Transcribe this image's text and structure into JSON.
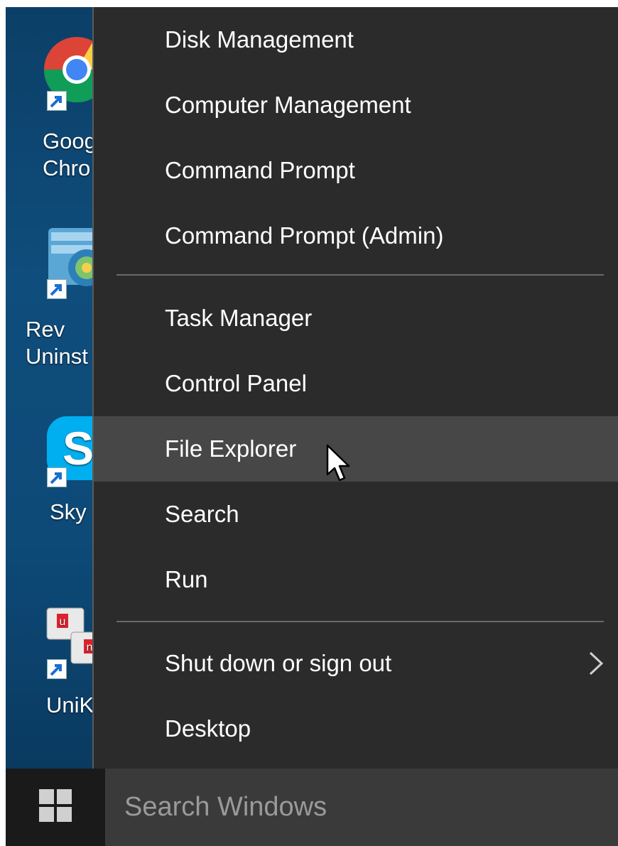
{
  "desktop": {
    "icons": [
      {
        "label": "Goog\nChro",
        "icon": "chrome-icon"
      },
      {
        "label": "Rev\nUninst",
        "icon": "revo-uninstaller-icon"
      },
      {
        "label": "Sky",
        "icon": "skype-icon"
      },
      {
        "label": "UniK",
        "icon": "unikey-icon"
      }
    ]
  },
  "menu": {
    "items": [
      {
        "label": "Disk Management"
      },
      {
        "label": "Computer Management"
      },
      {
        "label": "Command Prompt"
      },
      {
        "label": "Command Prompt (Admin)"
      },
      {
        "label": "Task Manager"
      },
      {
        "label": "Control Panel"
      },
      {
        "label": "File Explorer",
        "highlighted": true
      },
      {
        "label": "Search"
      },
      {
        "label": "Run"
      },
      {
        "label": "Shut down or sign out",
        "submenu": true
      },
      {
        "label": "Desktop"
      }
    ]
  },
  "taskbar": {
    "start_icon": "windows-logo-icon",
    "search_placeholder": "Search Windows"
  },
  "colors": {
    "menu_bg": "#2b2b2b",
    "menu_highlight": "#474747",
    "menu_text": "#ffffff",
    "taskbar_bg": "#1a1a1a",
    "search_bg": "#3a3a3a"
  }
}
